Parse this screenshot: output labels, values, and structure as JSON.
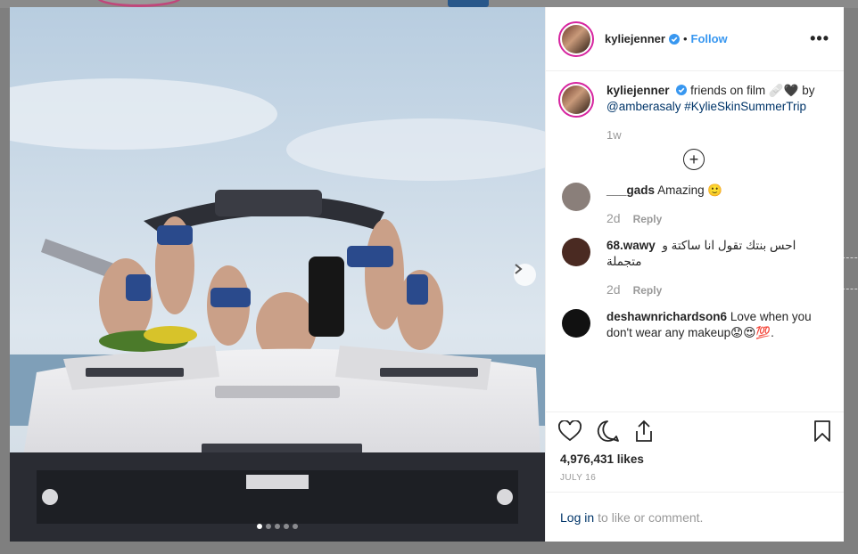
{
  "post": {
    "username": "kyliejenner",
    "follow_label": "Follow",
    "separator": "•",
    "more_label": "•••",
    "caption_text": "friends on film 🩹🖤 by",
    "caption_mention": "@amberasaly",
    "caption_hashtag": "#KylieSkinSummerTrip",
    "time_ago": "1w",
    "load_more_symbol": "+",
    "likes": "4,976,431 likes",
    "date": "JULY 16",
    "login_link": "Log in",
    "login_rest": "to like or comment."
  },
  "comments": [
    {
      "username": "___gads",
      "text": "Amazing 🙂",
      "age": "2d",
      "reply": "Reply",
      "avatar_color": "#8a7f7a"
    },
    {
      "username": "68.wawy",
      "text": "احس بنتك تقول انا ساكتة و متجملة",
      "age": "2d",
      "reply": "Reply",
      "avatar_color": "#4a2a22"
    },
    {
      "username": "deshawnrichardson6",
      "text": "Love when you don't wear any makeup😟😍💯.",
      "age": "",
      "reply": "",
      "avatar_color": "#111111"
    }
  ],
  "carousel": {
    "count": 5,
    "active": 1
  },
  "colors": {
    "accent": "#3897f0",
    "link": "#003569",
    "verified": "#3897f0"
  },
  "icons": [
    "verified-badge-icon",
    "more-options-icon",
    "chevron-right-icon",
    "plus-circle-icon",
    "heart-icon",
    "comment-icon",
    "share-icon",
    "bookmark-icon"
  ]
}
